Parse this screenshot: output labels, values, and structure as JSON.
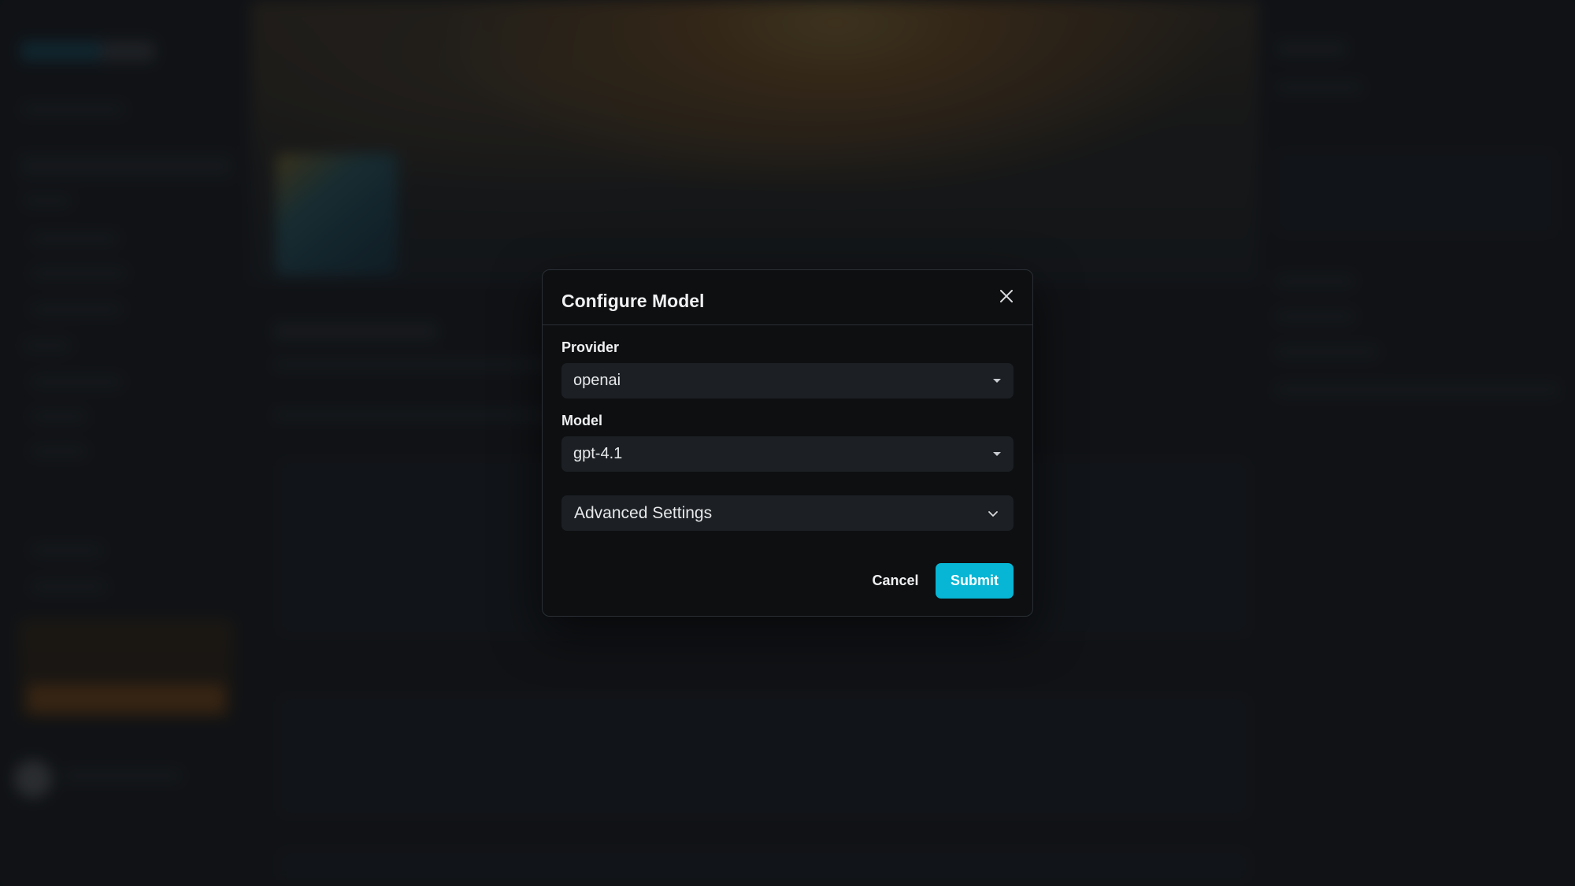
{
  "modal": {
    "title": "Configure Model",
    "close_icon": "close-icon",
    "provider": {
      "label": "Provider",
      "value": "openai"
    },
    "model": {
      "label": "Model",
      "value": "gpt-4.1"
    },
    "advanced": {
      "label": "Advanced Settings",
      "icon": "chevron-down-icon"
    },
    "cancel_label": "Cancel",
    "submit_label": "Submit"
  },
  "colors": {
    "accent": "#06b6d4",
    "modal_bg": "#0d0f11",
    "field_bg": "#1c1f23"
  }
}
